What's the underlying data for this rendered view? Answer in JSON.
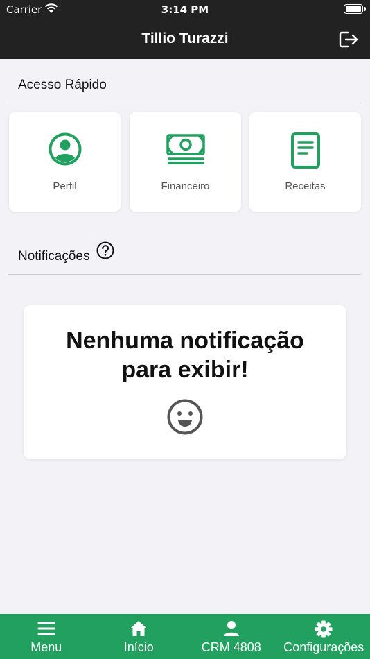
{
  "status_bar": {
    "carrier": "Carrier",
    "time": "3:14 PM"
  },
  "header": {
    "title": "Tillio Turazzi",
    "logout_icon": "logout-icon"
  },
  "quick_access": {
    "title": "Acesso Rápido",
    "items": [
      {
        "label": "Perfil",
        "icon": "profile-icon"
      },
      {
        "label": "Financeiro",
        "icon": "money-icon"
      },
      {
        "label": "Receitas",
        "icon": "document-icon"
      }
    ]
  },
  "notifications": {
    "title": "Notificações",
    "empty_line1": "Nenhuma notificação",
    "empty_line2": "para exibir!"
  },
  "tab_bar": {
    "items": [
      {
        "label": "Menu",
        "icon": "menu-icon"
      },
      {
        "label": "Início",
        "icon": "home-icon"
      },
      {
        "label": "CRM 4808",
        "icon": "person-icon"
      },
      {
        "label": "Configurações",
        "icon": "gear-icon"
      }
    ]
  },
  "colors": {
    "accent": "#22a060",
    "header_bg": "#222222",
    "page_bg": "#f2f2f7"
  }
}
